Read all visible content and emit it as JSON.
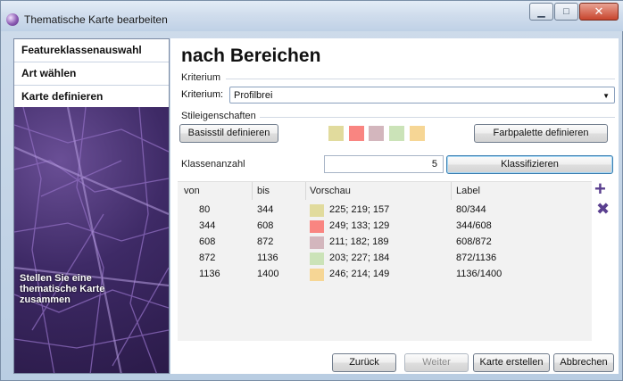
{
  "window": {
    "title": "Thematische Karte bearbeiten"
  },
  "sidebar": {
    "items": [
      {
        "label": "Featureklassenauswahl",
        "active": false
      },
      {
        "label": "Art wählen",
        "active": false
      },
      {
        "label": "Karte definieren",
        "active": true
      }
    ],
    "description": "Stellen Sie eine thematische Karte zusammen"
  },
  "page": {
    "title": "nach Bereichen"
  },
  "criterion": {
    "group_label": "Kriterium",
    "field_label": "Kriterium:",
    "selected": "Profilbrei"
  },
  "style": {
    "group_label": "Stileigenschaften",
    "base_style_button": "Basisstil definieren",
    "palette_button": "Farbpalette definieren",
    "palette_colors": [
      "#e1db9d",
      "#f98581",
      "#d3b6bd",
      "#cbe3b8",
      "#f6d695"
    ]
  },
  "classes": {
    "count_label": "Klassenanzahl",
    "count_value": "5",
    "classify_button": "Klassifizieren"
  },
  "table": {
    "columns": [
      "von",
      "bis",
      "Vorschau",
      "Label"
    ],
    "rows": [
      {
        "von": "80",
        "bis": "344",
        "vorschau": "225; 219; 157",
        "color": "#e1db9d",
        "label": "80/344"
      },
      {
        "von": "344",
        "bis": "608",
        "vorschau": "249; 133; 129",
        "color": "#f98581",
        "label": "344/608"
      },
      {
        "von": "608",
        "bis": "872",
        "vorschau": "211; 182; 189",
        "color": "#d3b6bd",
        "label": "608/872"
      },
      {
        "von": "872",
        "bis": "1136",
        "vorschau": "203; 227; 184",
        "color": "#cbe3b8",
        "label": "872/1136"
      },
      {
        "von": "1136",
        "bis": "1400",
        "vorschau": "246; 214; 149",
        "color": "#f6d695",
        "label": "1136/1400"
      }
    ]
  },
  "icons": {
    "add": "plus-icon",
    "remove": "x-icon"
  },
  "footer": {
    "back": "Zurück",
    "next": "Weiter",
    "create": "Karte erstellen",
    "cancel": "Abbrechen"
  }
}
